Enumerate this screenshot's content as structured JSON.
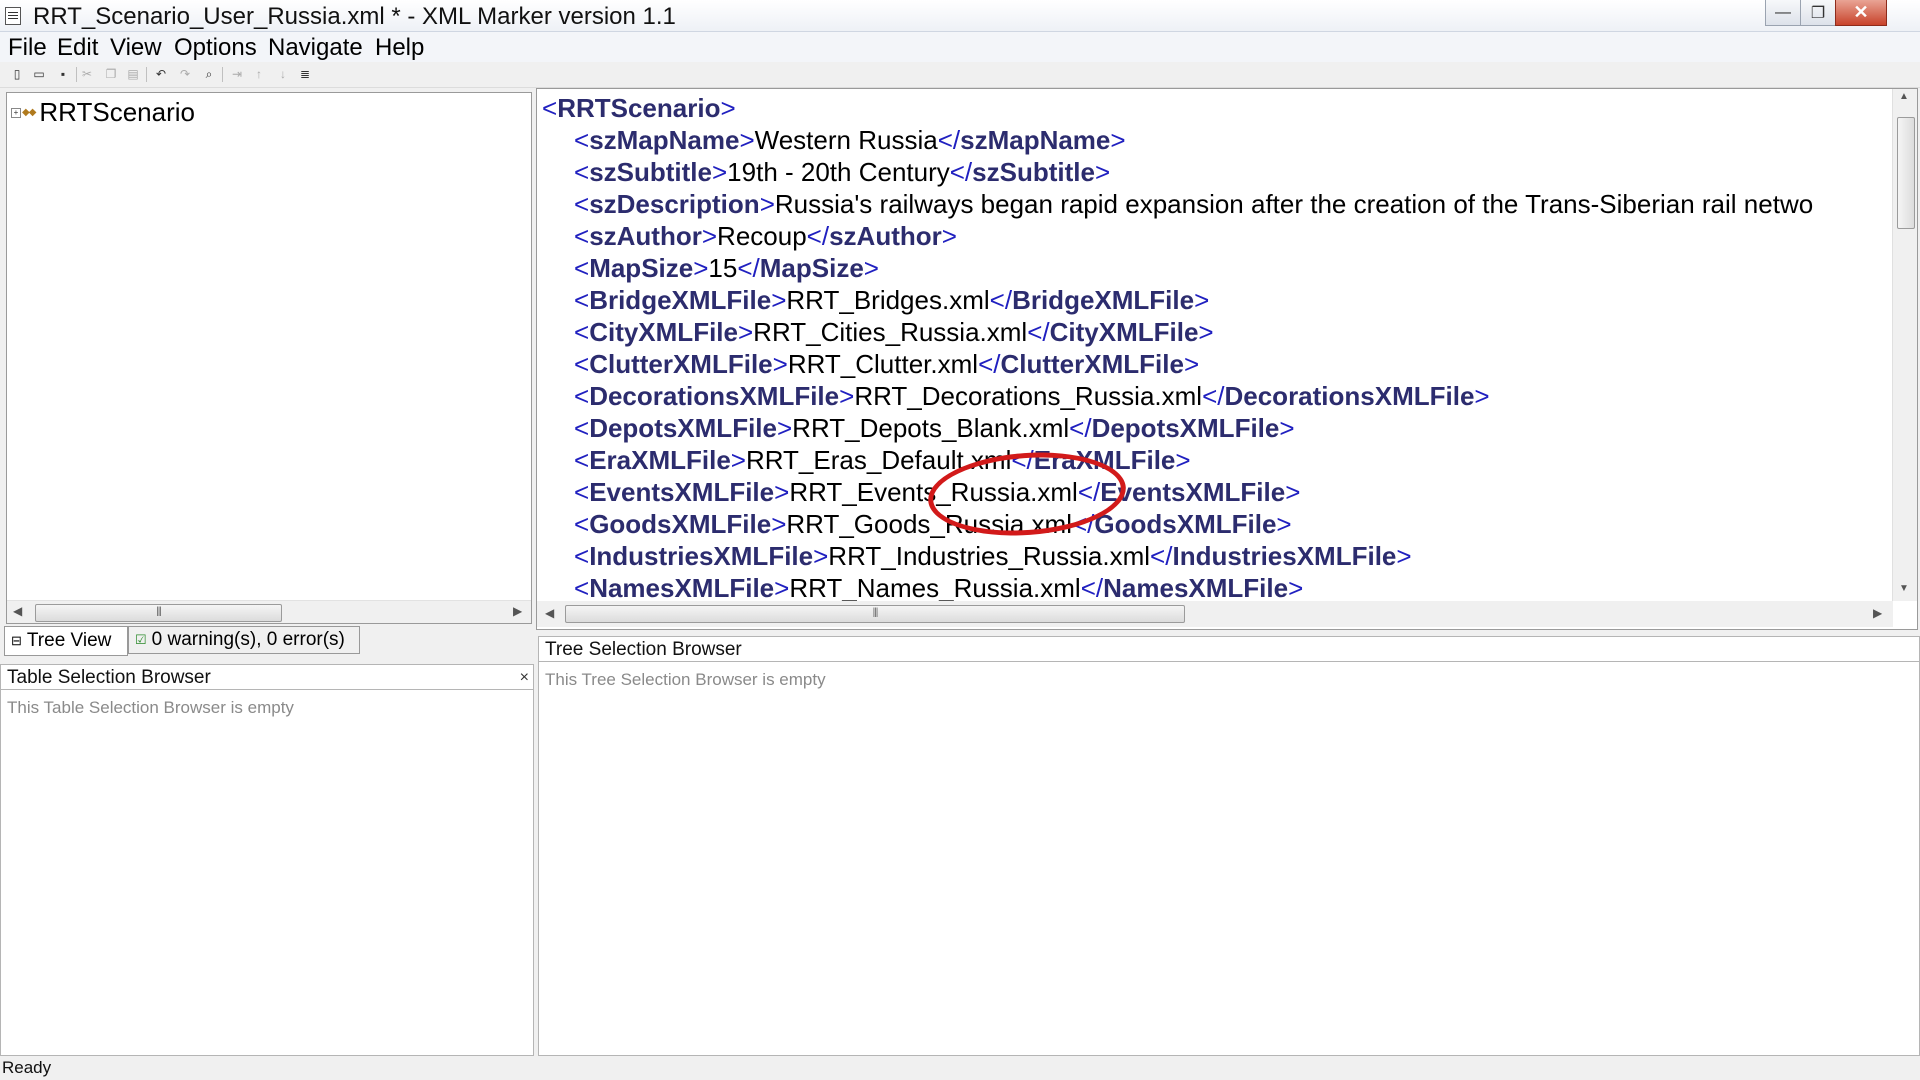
{
  "window": {
    "title": "RRT_Scenario_User_Russia.xml *  -  XML Marker version 1.1",
    "minimize": "—",
    "restore": "❐",
    "close": "✕"
  },
  "menu": [
    "File",
    "Edit",
    "View",
    "Options",
    "Navigate",
    "Help"
  ],
  "toolbar": [
    "new-file-icon",
    "open-icon",
    "save-icon",
    "cut-icon",
    "copy-icon",
    "paste-icon",
    "undo-icon",
    "redo-icon",
    "find-icon",
    "indent-icon",
    "move-up-icon",
    "move-down-icon",
    "format-icon"
  ],
  "tree": {
    "root_label": "RRTScenario",
    "expand_glyph": "+",
    "node_glyph": "◆◆",
    "grip": "|||"
  },
  "tabs": {
    "tree_view": "Tree View",
    "warnings": "0 warning(s), 0 error(s)"
  },
  "xml": {
    "lines": [
      {
        "tag": "RRTScenario",
        "text": "",
        "close": false,
        "indent": 0
      },
      {
        "tag": "szMapName",
        "text": "Western Russia",
        "close": true,
        "indent": 1
      },
      {
        "tag": "szSubtitle",
        "text": "19th - 20th Century",
        "close": true,
        "indent": 1
      },
      {
        "tag": "szDescription",
        "text": "Russia's railways began rapid expansion after the creation of the Trans-Siberian rail netwo",
        "close": false,
        "indent": 1
      },
      {
        "tag": "szAuthor",
        "text": "Recoup",
        "close": true,
        "indent": 1
      },
      {
        "tag": "MapSize",
        "text": "15",
        "close": true,
        "indent": 1
      },
      {
        "tag": "BridgeXMLFile",
        "text": "RRT_Bridges.xml",
        "close": true,
        "indent": 1
      },
      {
        "tag": "CityXMLFile",
        "text": "RRT_Cities_Russia.xml",
        "close": true,
        "indent": 1
      },
      {
        "tag": "ClutterXMLFile",
        "text": "RRT_Clutter.xml",
        "close": true,
        "indent": 1
      },
      {
        "tag": "DecorationsXMLFile",
        "text": "RRT_Decorations_Russia.xml",
        "close": true,
        "indent": 1
      },
      {
        "tag": "DepotsXMLFile",
        "text": "RRT_Depots_Blank.xml",
        "close": true,
        "indent": 1
      },
      {
        "tag": "EraXMLFile",
        "text": "RRT_Eras_Default.xml",
        "close": true,
        "indent": 1
      },
      {
        "tag": "EventsXMLFile",
        "text": "RRT_Events_Russia.xml",
        "close": true,
        "indent": 1
      },
      {
        "tag": "GoodsXMLFile",
        "text": "RRT_Goods_Russia.xml",
        "close": true,
        "indent": 1
      },
      {
        "tag": "IndustriesXMLFile",
        "text": "RRT_Industries_Russia.xml",
        "close": true,
        "indent": 1
      },
      {
        "tag": "NamesXMLFile",
        "text": "RRT_Names_Russia.xml",
        "close": true,
        "indent": 1
      }
    ],
    "highlighted_line": 12,
    "highlight_color": "#d21a1a"
  },
  "table_browser": {
    "title": "Table Selection Browser",
    "empty": "This Table Selection Browser is empty",
    "close": "×"
  },
  "tree_browser": {
    "title": "Tree Selection Browser",
    "empty": "This Tree Selection Browser is empty"
  },
  "status": "Ready"
}
